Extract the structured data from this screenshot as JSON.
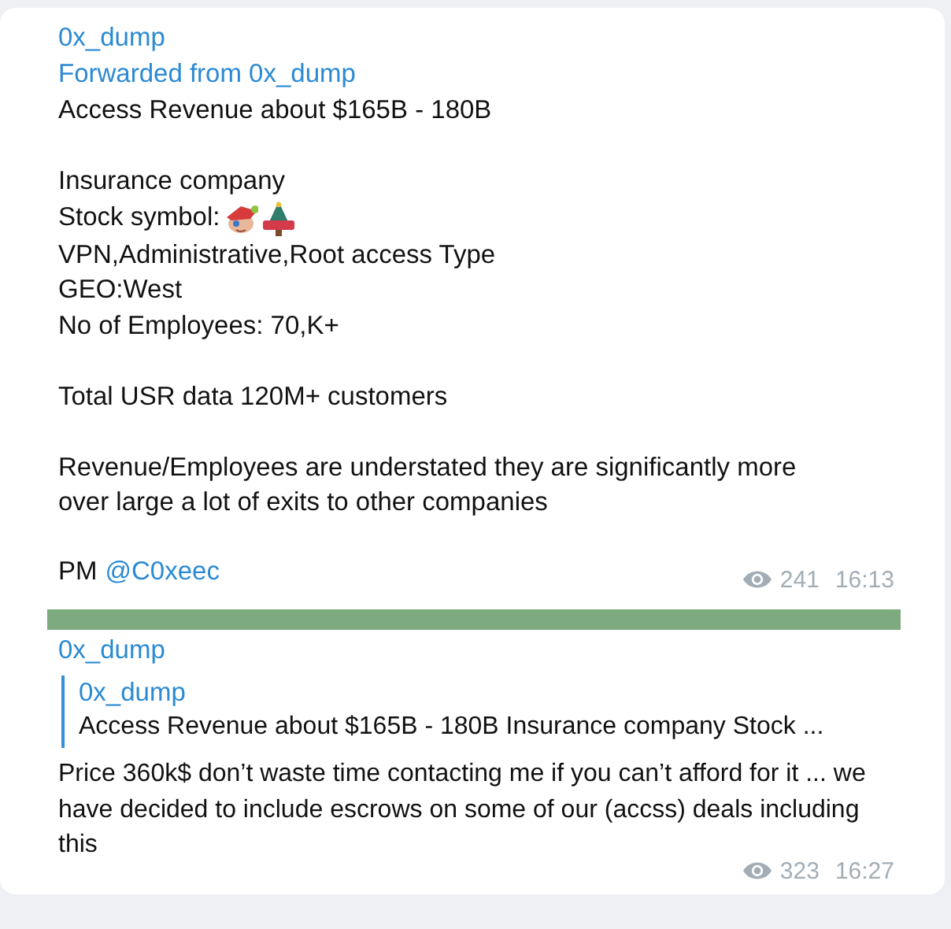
{
  "messages": [
    {
      "author": "0x_dump",
      "forwarded_from": "Forwarded from 0x_dump",
      "paragraphs": [
        [
          {
            "kind": "plain",
            "text": "Access Revenue about $165B - 180B"
          }
        ],
        [
          {
            "kind": "plain",
            "text": "Insurance company"
          },
          {
            "kind": "stickers",
            "text": "Stock symbol:"
          },
          {
            "kind": "plain",
            "text": "VPN,Administrative,Root access Type"
          },
          {
            "kind": "plain",
            "text": "GEO:West"
          },
          {
            "kind": "plain",
            "text": "No of Employees: 70,K+"
          }
        ],
        [
          {
            "kind": "plain",
            "text": "Total USR data 120M+ customers"
          }
        ],
        [
          {
            "kind": "plain",
            "text": "Revenue/Employees are understated they are significantly more over large a lot of exits to other companies"
          }
        ]
      ],
      "footer_text": "PM",
      "mention": "@C0xeec",
      "views": "241",
      "time": "16:13"
    },
    {
      "author": "0x_dump",
      "reply": {
        "author": "0x_dump",
        "text": "Access Revenue about $165B - 180B  Insurance company  Stock ..."
      },
      "body": "Price 360k$ don’t waste time contacting me if you can’t afford for it ... we have decided to include escrows on some of our (accss) deals including this",
      "views": "323",
      "time": "16:27"
    }
  ]
}
